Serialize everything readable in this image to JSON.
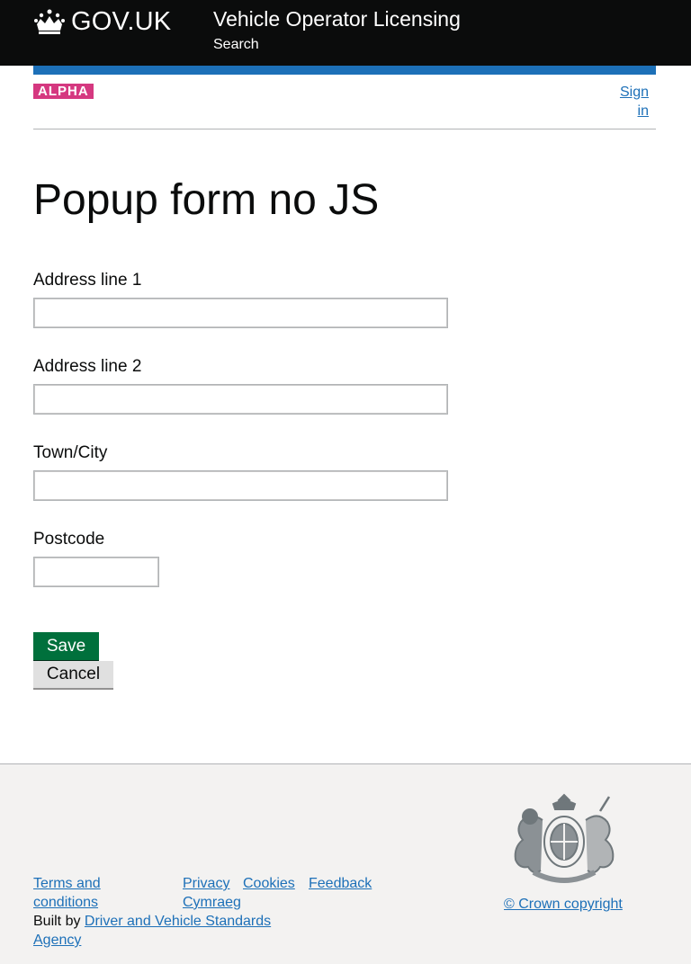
{
  "header": {
    "logo_text": "GOV.UK",
    "logo_icon": "crown-icon",
    "service_name": "Vehicle Operator Licensing",
    "search_link": "Search"
  },
  "phase": {
    "tag": "ALPHA"
  },
  "account": {
    "sign_in": "Sign in"
  },
  "main": {
    "title": "Popup form no JS",
    "fields": [
      {
        "label": "Address line 1",
        "value": ""
      },
      {
        "label": "Address line 2",
        "value": ""
      },
      {
        "label": "Town/City",
        "value": ""
      },
      {
        "label": "Postcode",
        "value": ""
      }
    ],
    "save_label": "Save",
    "cancel_label": "Cancel"
  },
  "footer": {
    "links": {
      "terms": "Terms and conditions",
      "privacy": "Privacy",
      "cookies": "Cookies",
      "feedback": "Feedback",
      "cymraeg": "Cymraeg"
    },
    "built_by_prefix": "Built by ",
    "built_by_link": "Driver and Vehicle Standards Agency",
    "copyright": "© Crown copyright",
    "crest_icon": "royal-coat-of-arms-icon"
  },
  "colors": {
    "header_bg": "#0b0c0c",
    "brand_blue": "#1d70b8",
    "alpha_tag": "#d53880",
    "save_button": "#00703c",
    "cancel_button": "#e0e0e0",
    "footer_bg": "#f3f2f1"
  }
}
